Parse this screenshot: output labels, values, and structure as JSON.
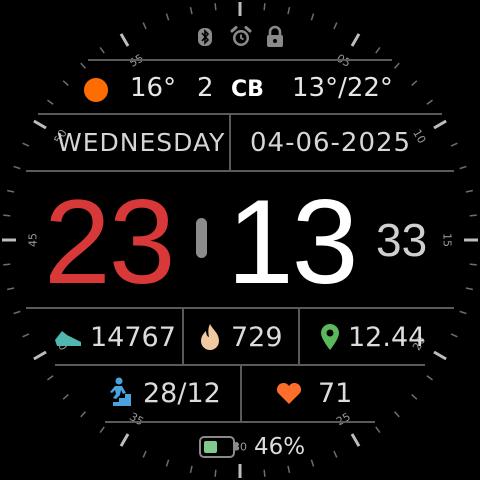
{
  "status_icons": [
    "bluetooth-icon",
    "alarm-icon",
    "lock-icon"
  ],
  "weather": {
    "condition_icon": "sun-icon",
    "temperature": "16°",
    "uv_index": "2",
    "air_quality": "CB",
    "min_max": "13°/22°"
  },
  "date": {
    "weekday": "WEDNESDAY",
    "full_date": "04-06-2025"
  },
  "time": {
    "hours": "23",
    "minutes": "13",
    "seconds": "33"
  },
  "stats": {
    "steps": "14767",
    "calories": "729",
    "distance": "12.44",
    "floors": "28/12",
    "heart_rate": "71"
  },
  "battery": {
    "percent_label": "46%",
    "level": 0.46
  },
  "bezel": {
    "labels": [
      "05",
      "10",
      "15",
      "20",
      "25",
      "30",
      "35",
      "40",
      "45",
      "50",
      "55"
    ]
  },
  "colors": {
    "hours": "#d93838",
    "minutes": "#ffffff",
    "seconds": "#cfcfcf",
    "sun": "#ff6d00",
    "steps_icon": "#4fb6b0",
    "calories_icon": "#f1c9a0",
    "distance_icon": "#5cb85c",
    "floors_icon": "#4aa3e0",
    "heart_icon": "#ff6d2a",
    "battery_fill": "#7fca8c"
  }
}
